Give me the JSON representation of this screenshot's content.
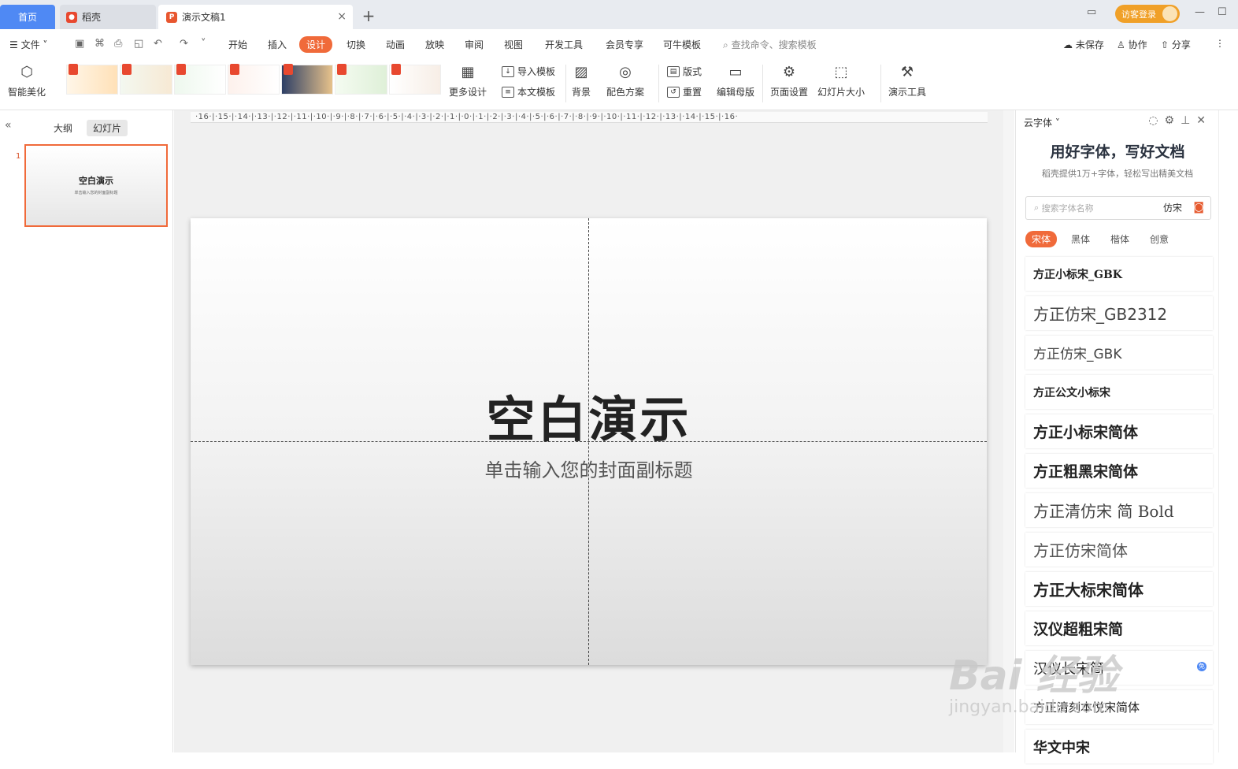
{
  "tabs": {
    "home": "首页",
    "daoke": "稻壳",
    "document": "演示文稿1",
    "add": "+",
    "close": "×"
  },
  "login": "访客登录",
  "menu": {
    "file": "文件",
    "items": [
      "开始",
      "插入",
      "设计",
      "切换",
      "动画",
      "放映",
      "审阅",
      "视图",
      "开发工具",
      "会员专享",
      "可牛模板"
    ],
    "active": "设计",
    "search": "查找命令、搜索模板",
    "unsaved": "未保存",
    "collab": "协作",
    "share": "分享"
  },
  "ribbon": {
    "beautify": "智能美化",
    "more_design": "更多设计",
    "import_template": "导入模板",
    "this_template": "本文模板",
    "background": "背景",
    "color_scheme": "配色方案",
    "layout": "版式",
    "reset": "重置",
    "edit_master": "编辑母版",
    "page_setup": "页面设置",
    "slide_size": "幻灯片大小",
    "present_tools": "演示工具"
  },
  "left_panel": {
    "outline": "大纲",
    "slides": "幻灯片",
    "slide_number": "1",
    "thumb_title": "空白演示",
    "thumb_sub": "单击输入您的封面副标题"
  },
  "ruler": "·16·|·15·|·14·|·13·|·12·|·11·|·10·|·9·|·8·|·7·|·6·|·5·|·4·|·3·|·2·|·1·|·0·|·1·|·2·|·3·|·4·|·5·|·6·|·7·|·8·|·9·|·10·|·11·|·12·|·13·|·14·|·15·|·16·",
  "slide": {
    "title": "空白演示",
    "subtitle": "单击输入您的封面副标题"
  },
  "right_panel": {
    "header": "云字体",
    "headline": "用好字体，写好文档",
    "subline": "稻壳提供1万+字体，轻松写出精美文档",
    "search_placeholder": "搜索字体名称",
    "search_tag": "仿宋",
    "categories": [
      "宋体",
      "黑体",
      "楷体",
      "创意"
    ],
    "fonts": [
      "方正小标宋_GBK",
      "方正仿宋_GB2312",
      "方正仿宋_GBK",
      "方正公文小标宋",
      "方正小标宋简体",
      "方正粗黑宋简体",
      "方正清仿宋 简 Bold",
      "方正仿宋简体",
      "方正大标宋简体",
      "汉仪超粗宋简",
      "汉仪长宋简",
      "方正清刻本悦宋简体",
      "华文中宋"
    ],
    "free_badge": "免"
  },
  "watermark": {
    "brand": "Bai 经验",
    "url": "jingyan.baidu.com"
  }
}
